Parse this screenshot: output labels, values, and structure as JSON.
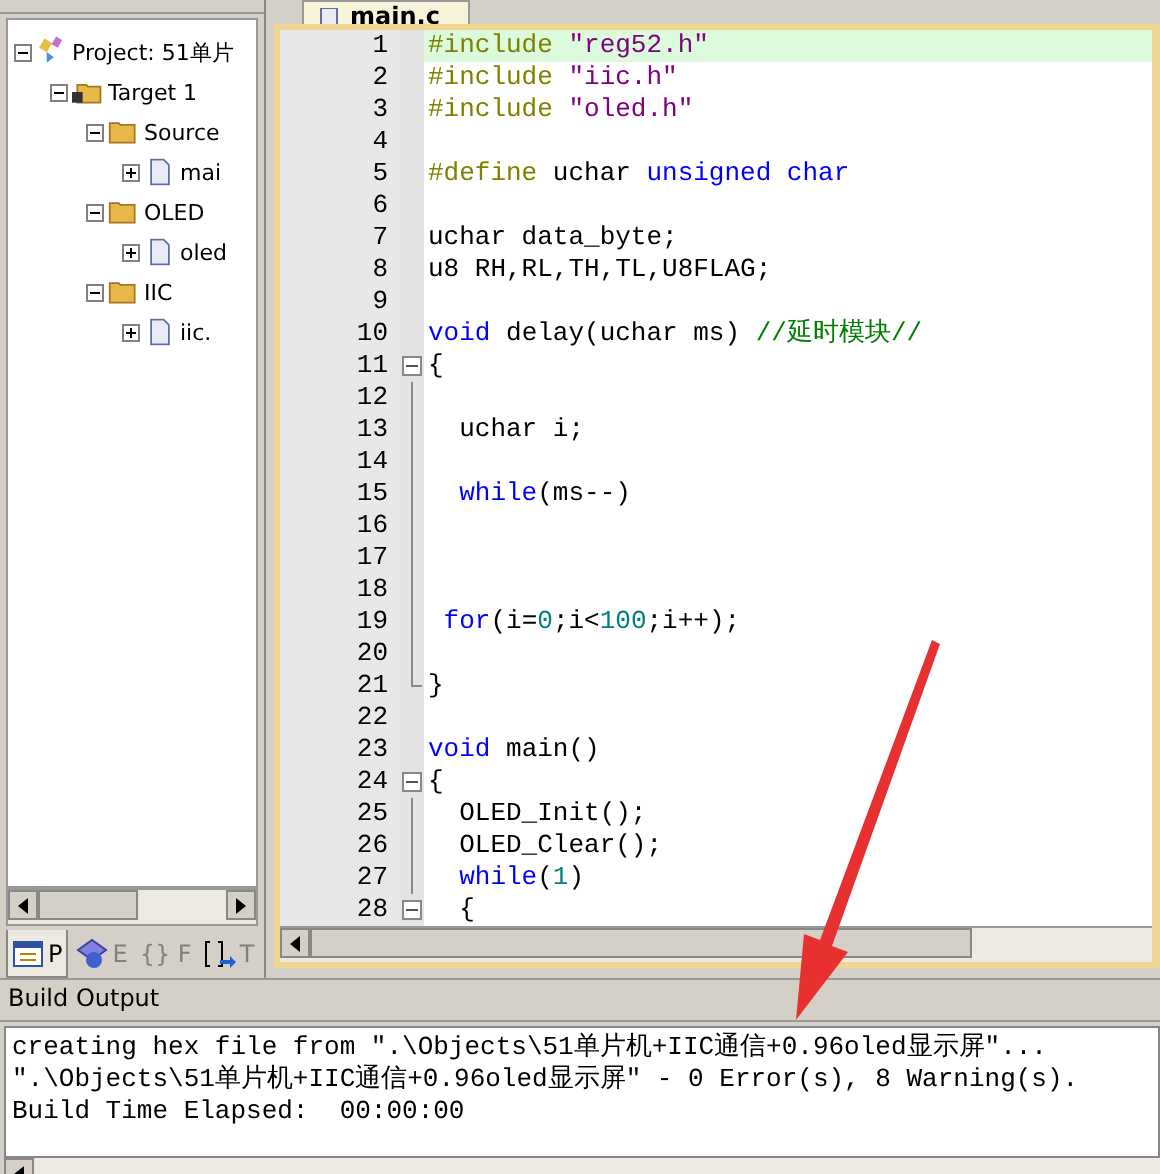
{
  "project_tree": [
    {
      "kind": "project",
      "label": "Project: 51单片",
      "expanded": true,
      "children": [
        {
          "kind": "target",
          "label": "Target 1",
          "expanded": true,
          "children": [
            {
              "kind": "group",
              "label": "Source",
              "expanded": true,
              "children": [
                {
                  "kind": "file",
                  "label": "mai",
                  "expanded": false
                }
              ]
            },
            {
              "kind": "group",
              "label": "OLED",
              "expanded": true,
              "children": [
                {
                  "kind": "file",
                  "label": "oled",
                  "expanded": false
                }
              ]
            },
            {
              "kind": "group",
              "label": "IIC",
              "expanded": true,
              "children": [
                {
                  "kind": "file",
                  "label": "iic.",
                  "expanded": false
                }
              ]
            }
          ]
        }
      ]
    }
  ],
  "panel_tabs": [
    {
      "kind": "project",
      "label": "P",
      "selected": true
    },
    {
      "kind": "books",
      "label": "E",
      "selected": false
    },
    {
      "kind": "functions",
      "glyph": "{}",
      "label": "F",
      "selected": false
    },
    {
      "kind": "templates",
      "label": "T",
      "selected": false
    }
  ],
  "editor": {
    "tab": "main.c",
    "lines": [
      {
        "n": "1",
        "current": true,
        "tokens": [
          {
            "kind": "pre",
            "text": "#include"
          },
          {
            "kind": "string",
            "text": " \"reg52.h\""
          }
        ]
      },
      {
        "n": "2",
        "current": false,
        "tokens": [
          {
            "kind": "pre",
            "text": "#include"
          },
          {
            "kind": "string",
            "text": " \"iic.h\""
          }
        ]
      },
      {
        "n": "3",
        "current": false,
        "tokens": [
          {
            "kind": "pre",
            "text": "#include"
          },
          {
            "kind": "string",
            "text": " \"oled.h\""
          }
        ]
      },
      {
        "n": "4",
        "current": false
      },
      {
        "n": "5",
        "current": false,
        "tokens": [
          {
            "kind": "pre",
            "text": "#define"
          },
          {
            "kind": "plain",
            "text": " uchar "
          },
          {
            "kind": "keyword",
            "text": "unsigned char"
          }
        ]
      },
      {
        "n": "6",
        "current": false
      },
      {
        "n": "7",
        "current": false,
        "tokens": [
          {
            "kind": "plain",
            "text": "uchar data_byte;"
          }
        ]
      },
      {
        "n": "8",
        "current": false,
        "tokens": [
          {
            "kind": "plain",
            "text": "u8 RH,RL,TH,TL,U8FLAG;"
          }
        ]
      },
      {
        "n": "9",
        "current": false
      },
      {
        "n": "10",
        "current": false,
        "tokens": [
          {
            "kind": "keyword",
            "text": "void"
          },
          {
            "kind": "plain",
            "text": " delay(uchar ms) "
          },
          {
            "kind": "comment",
            "text": "//延时模块//"
          }
        ]
      },
      {
        "n": "11",
        "current": false,
        "fold_open": true,
        "tokens": [
          {
            "kind": "plain",
            "text": "{"
          }
        ]
      },
      {
        "n": "12",
        "current": false,
        "guide": true
      },
      {
        "n": "13",
        "current": false,
        "guide": true,
        "tokens": [
          {
            "kind": "plain",
            "text": "  uchar i;"
          }
        ]
      },
      {
        "n": "14",
        "current": false,
        "guide": true
      },
      {
        "n": "15",
        "current": false,
        "guide": true,
        "tokens": [
          {
            "kind": "keyword",
            "text": "  while"
          },
          {
            "kind": "plain",
            "text": "(ms--)"
          }
        ]
      },
      {
        "n": "16",
        "current": false,
        "guide": true
      },
      {
        "n": "17",
        "current": false,
        "guide": true
      },
      {
        "n": "18",
        "current": false,
        "guide": true
      },
      {
        "n": "19",
        "current": false,
        "guide": true,
        "tokens": [
          {
            "kind": "keyword",
            "text": " for"
          },
          {
            "kind": "plain",
            "text": "(i="
          },
          {
            "kind": "number",
            "text": "0"
          },
          {
            "kind": "plain",
            "text": ";i<"
          },
          {
            "kind": "number",
            "text": "100"
          },
          {
            "kind": "plain",
            "text": ";i++);"
          }
        ]
      },
      {
        "n": "20",
        "current": false,
        "guide": true
      },
      {
        "n": "21",
        "current": false,
        "guide_end": true,
        "tokens": [
          {
            "kind": "plain",
            "text": "}"
          }
        ]
      },
      {
        "n": "22",
        "current": false
      },
      {
        "n": "23",
        "current": false,
        "tokens": [
          {
            "kind": "keyword",
            "text": "void"
          },
          {
            "kind": "plain",
            "text": " main()"
          }
        ]
      },
      {
        "n": "24",
        "current": false,
        "fold_open": true,
        "tokens": [
          {
            "kind": "plain",
            "text": "{"
          }
        ]
      },
      {
        "n": "25",
        "current": false,
        "guide": true,
        "tokens": [
          {
            "kind": "plain",
            "text": "  OLED_Init();"
          }
        ]
      },
      {
        "n": "26",
        "current": false,
        "guide": true,
        "tokens": [
          {
            "kind": "plain",
            "text": "  OLED_Clear();"
          }
        ]
      },
      {
        "n": "27",
        "current": false,
        "guide": true,
        "tokens": [
          {
            "kind": "keyword",
            "text": "  while"
          },
          {
            "kind": "plain",
            "text": "("
          },
          {
            "kind": "number",
            "text": "1"
          },
          {
            "kind": "plain",
            "text": ")"
          }
        ]
      },
      {
        "n": "28",
        "current": false,
        "fold_open": true,
        "tokens": [
          {
            "kind": "plain",
            "text": "  {"
          }
        ]
      }
    ]
  },
  "build_output": {
    "title": "Build Output",
    "lines": [
      "creating hex file from \".\\Objects\\51单片机+IIC通信+0.96oled显示屏\"...",
      "\".\\Objects\\51单片机+IIC通信+0.96oled显示屏\" - 0 Error(s), 8 Warning(s).",
      "Build Time Elapsed:  00:00:00"
    ]
  }
}
